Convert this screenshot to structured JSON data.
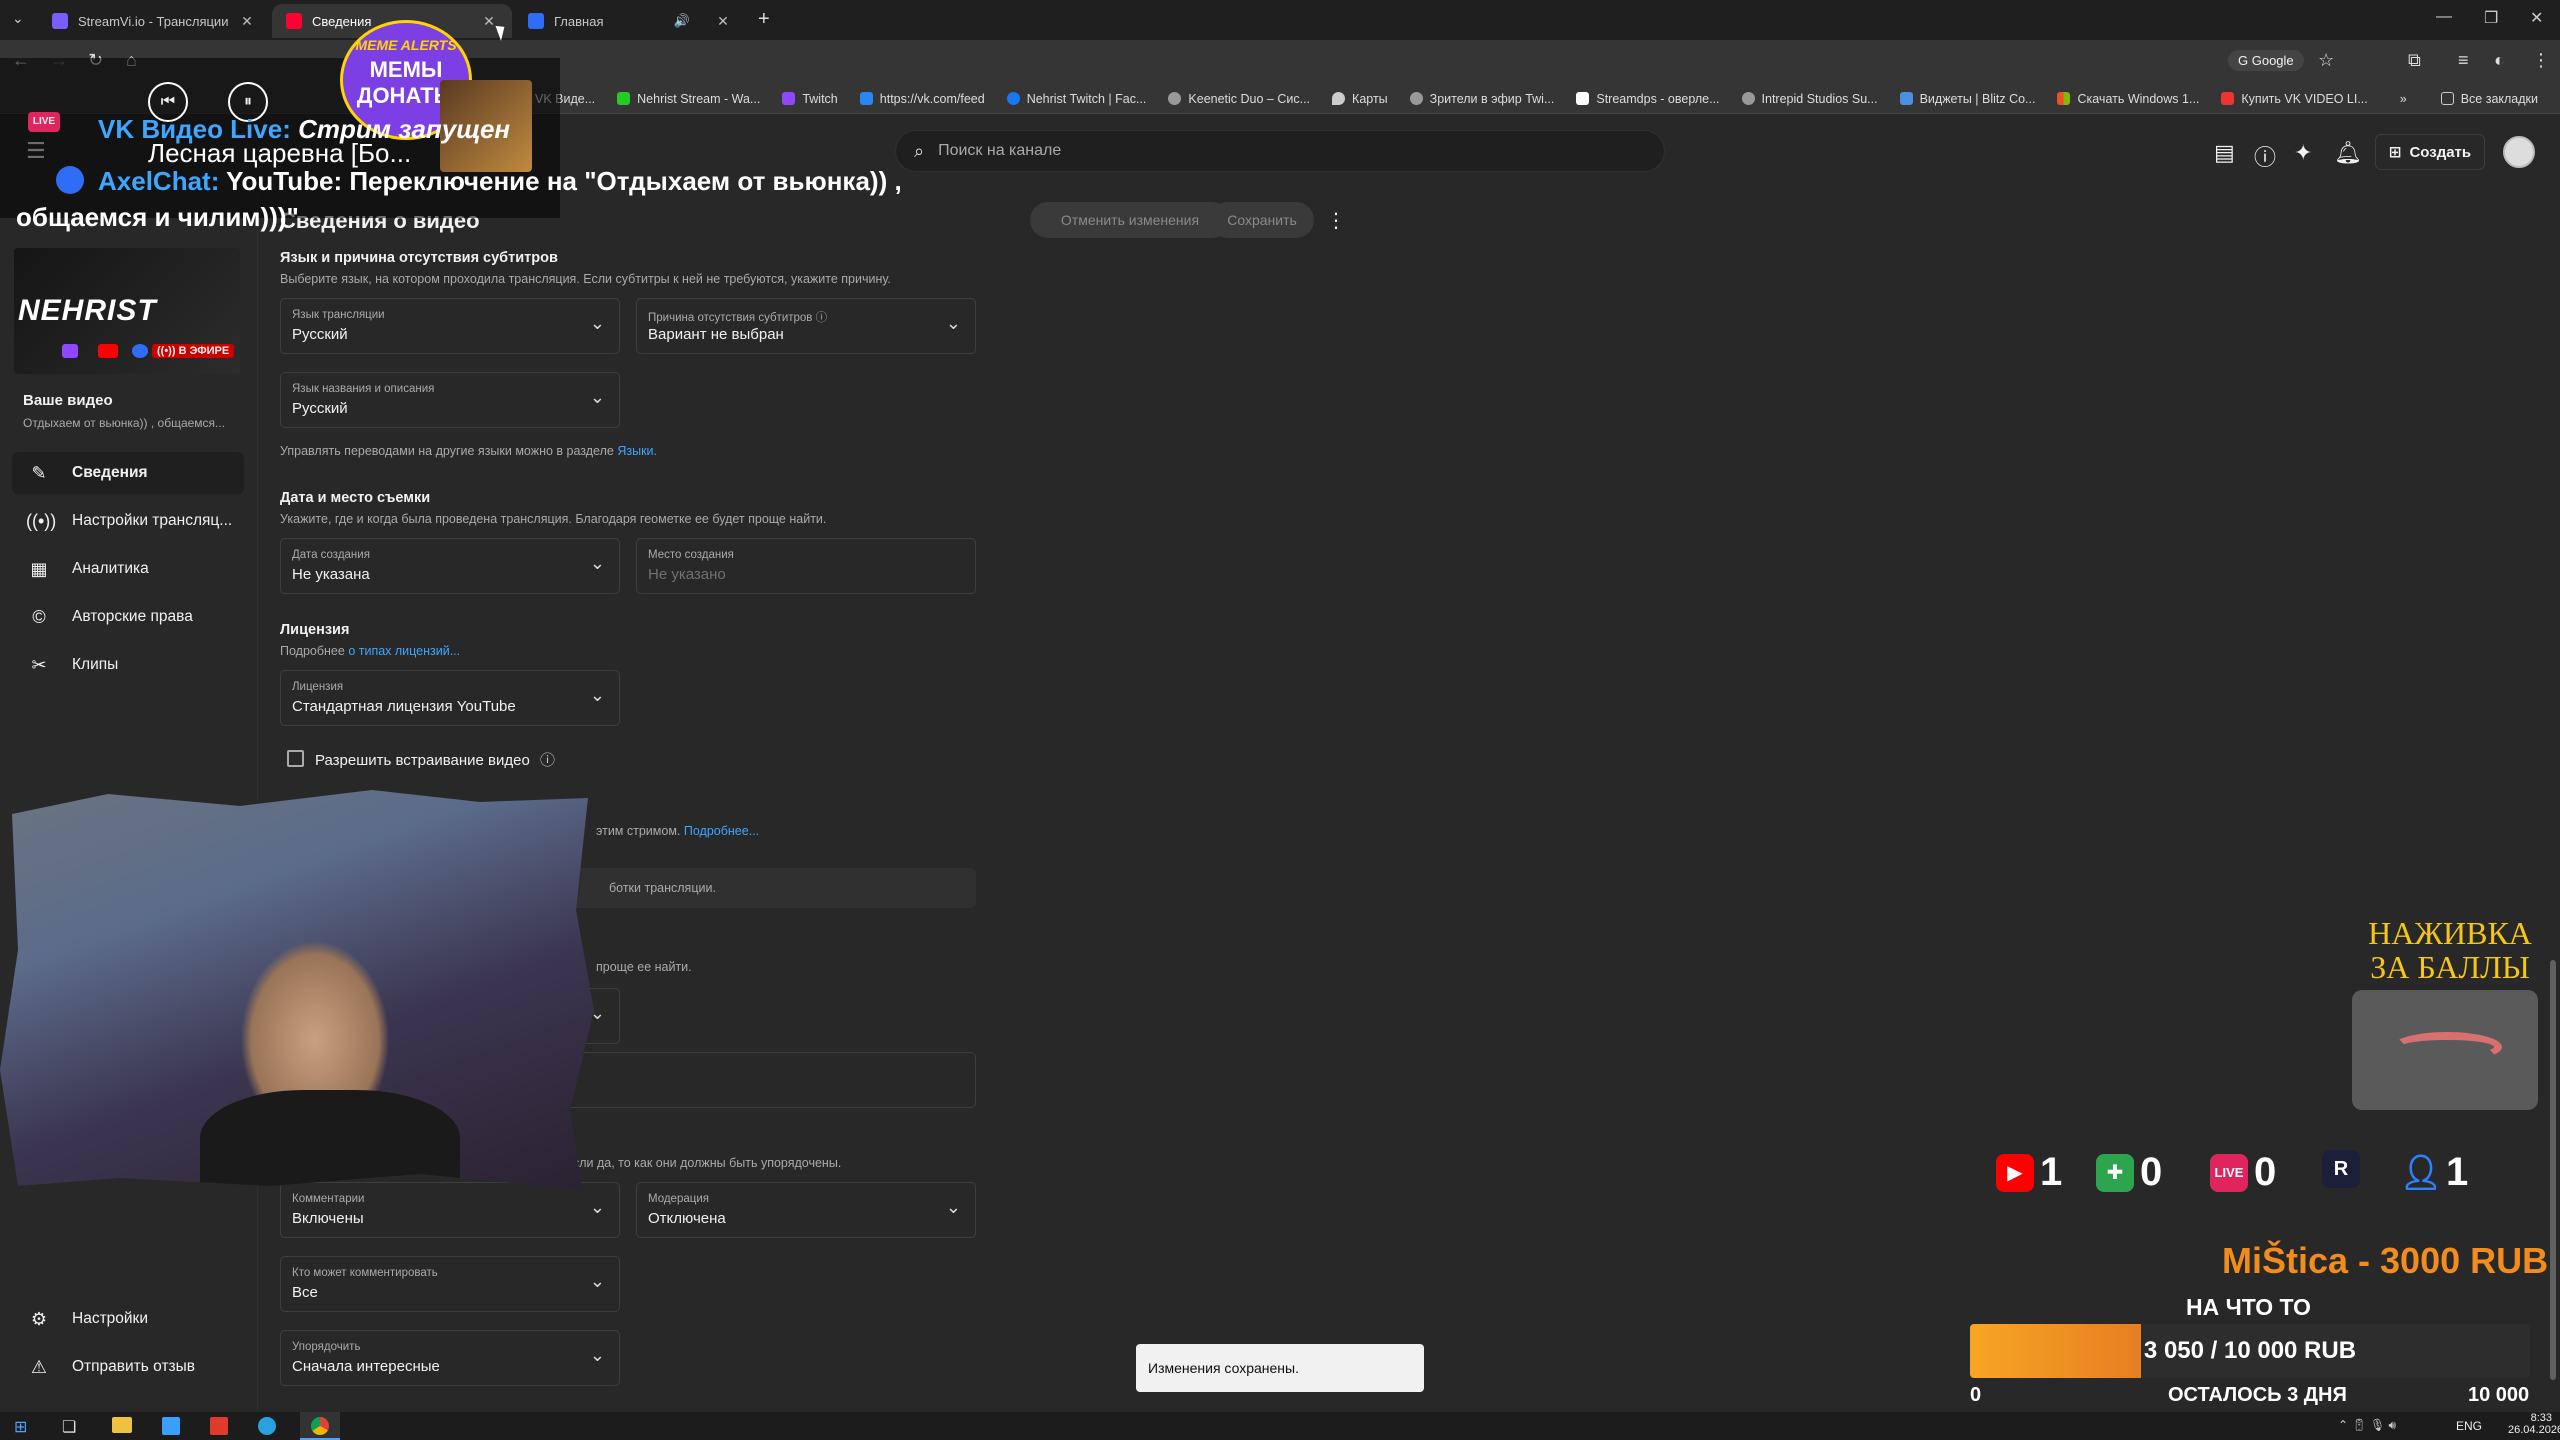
{
  "browser": {
    "tabs": [
      {
        "label": "StreamVi.io - Трансляции в не",
        "active": false
      },
      {
        "label": "Сведения",
        "active": true
      },
      {
        "label": "Главная",
        "active": false
      }
    ],
    "new_tab": "+",
    "omnibox_engine": "Google",
    "bookmarks": [
      "Студия — VK Виде...",
      "Nehrist Stream - Wa...",
      "Twitch",
      "https://vk.com/feed",
      "Nehrist Twitch | Fac...",
      "Keenetic Duo – Сис...",
      "Карты",
      "Зрители в эфир Twi...",
      "Streamdps - оверле...",
      "Intrepid Studios Su...",
      "Виджеты | Blitz Co...",
      "Скачать Windows 1...",
      "Купить VK VIDEO LI..."
    ],
    "all_bookmarks": "Все закладки",
    "more_bookmarks": "»"
  },
  "header": {
    "search_placeholder": "Поиск на канале",
    "create_label": "Создать"
  },
  "sidebar": {
    "your_video": "Ваше видео",
    "video_title": "Отдыхаем от вьюнка)) , общаемся...",
    "live_badge": "В ЭФИРЕ",
    "channel_logo": "NEHRIST",
    "items": [
      {
        "label": "Сведения",
        "icon": "pencil-icon",
        "active": true
      },
      {
        "label": "Настройки трансляц...",
        "icon": "broadcast-icon",
        "active": false
      },
      {
        "label": "Аналитика",
        "icon": "analytics-icon",
        "active": false
      },
      {
        "label": "Авторские права",
        "icon": "copyright-icon",
        "active": false
      },
      {
        "label": "Клипы",
        "icon": "scissors-icon",
        "active": false
      }
    ],
    "bottom_items": [
      {
        "label": "Настройки",
        "icon": "gear-icon"
      },
      {
        "label": "Отправить отзыв",
        "icon": "feedback-icon"
      }
    ]
  },
  "main": {
    "page_title": "Сведения о видео",
    "undo_label": "Отменить изменения",
    "save_label": "Сохранить",
    "subtitles_section": {
      "title": "Язык и причина отсутствия субтитров",
      "desc": "Выберите язык, на котором проходила трансляция. Если субтитры к ней не требуются, укажите причину.",
      "stream_language": {
        "label": "Язык трансляции",
        "value": "Русский"
      },
      "no_subtitles_reason": {
        "label": "Причина отсутствия субтитров",
        "value": "Вариант не выбран"
      },
      "title_language": {
        "label": "Язык названия и описания",
        "value": "Русский"
      },
      "translations_note": "Управлять переводами на другие языки можно в разделе",
      "translations_link": "Языки."
    },
    "date_section": {
      "title": "Дата и место съемки",
      "desc": "Укажите, где и когда была проведена трансляция. Благодаря геометке ее будет проще найти.",
      "created_date": {
        "label": "Дата создания",
        "value": "Не указана"
      },
      "location": {
        "label": "Место создания",
        "placeholder": "Не указано"
      }
    },
    "license_section": {
      "title": "Лицензия",
      "more_prefix": "Подробнее",
      "more_link": "о типах лицензий...",
      "license": {
        "label": "Лицензия",
        "value": "Стандартная лицензия YouTube"
      },
      "embed_label": "Разрешить встраивание видео"
    },
    "partial_texts": {
      "stream_more": "этим стримом.",
      "stream_more_link": "Подробнее...",
      "processing": "ботки трансляции.",
      "find_easier": "проще ее найти.",
      "comments_order": "если да, то как они должны быть упорядочены."
    },
    "comments": {
      "comments": {
        "label": "Комментарии",
        "value": "Включены"
      },
      "moderation": {
        "label": "Модерация",
        "value": "Отключена"
      },
      "who_can_comment": {
        "label": "Кто может комментировать",
        "value": "Все"
      },
      "sort": {
        "label": "Упорядочить",
        "value": "Сначала интересные"
      }
    },
    "toast": "Изменения сохранены."
  },
  "overlay": {
    "vk_live": "VK Видео Live:",
    "vk_live_status": "Стрим запущен",
    "song": "Лесная царевна [Бо...",
    "axel_chat": "AxelChat:",
    "axel_message": "YouTube: Переключение на \"Отдыхаем от вьюнка)) ,",
    "axel_message_2": "общаемся и чилим)))\"",
    "meme_badge_top": "MEME ALERTS",
    "meme_badge_main": "МЕМЫ ДОНАТЫ",
    "bait_title": "НАЖИВКА ЗА БАЛЛЫ",
    "counters": [
      {
        "platform": "youtube",
        "icon": "youtube-icon",
        "count": "1",
        "color": "#ff0000"
      },
      {
        "platform": "puzzle",
        "icon": "puzzle-icon",
        "count": "0",
        "color": "#2ea44f"
      },
      {
        "platform": "vk-live",
        "icon": "vk-live-icon",
        "count": "0",
        "color": "#e0245e"
      },
      {
        "platform": "rutube",
        "icon": "rutube-icon",
        "count": "",
        "color": "#1b1f3a"
      },
      {
        "platform": "viewers",
        "icon": "user-icon",
        "count": "1",
        "color": "#2f80ff"
      }
    ],
    "donation": "MiŠtica - 3000 RUB",
    "goal_title": "НА ЧТО ТО",
    "goal_progress_text": "3 050 / 10 000 RUB",
    "goal_fraction": 0.305,
    "goal_min": "0",
    "goal_max": "10 000",
    "goal_remaining": "ОСТАЛОСЬ 3 ДНЯ"
  },
  "taskbar": {
    "lang": "ENG",
    "time": "8:33",
    "date": "26.04.2026"
  }
}
